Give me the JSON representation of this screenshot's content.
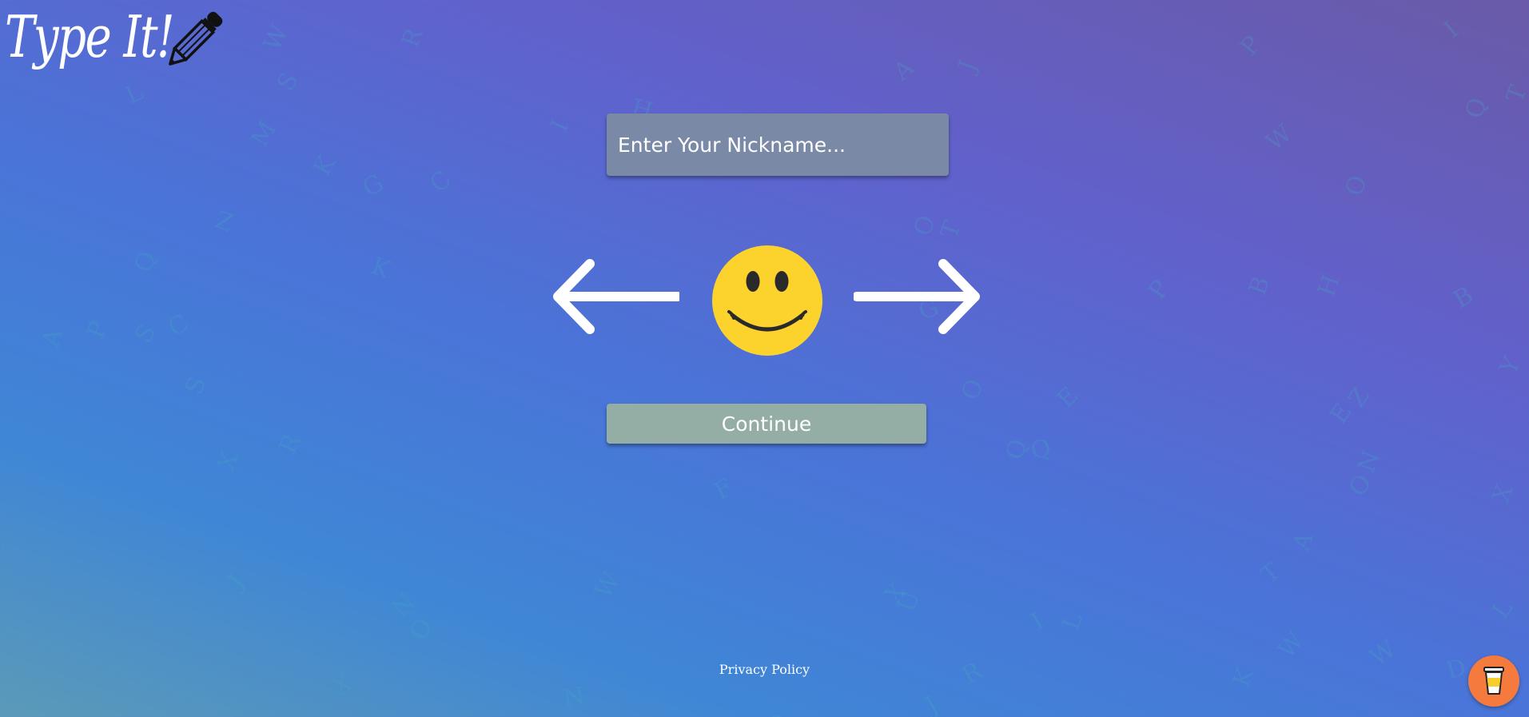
{
  "logo": {
    "title": "Type It!",
    "icon": "pencil-icon"
  },
  "nickname": {
    "placeholder": "Enter Your Nickname...",
    "value": ""
  },
  "avatar": {
    "icon": "smiley-face-icon",
    "prev_icon": "arrow-left-icon",
    "next_icon": "arrow-right-icon"
  },
  "continue_label": "Continue",
  "footer": {
    "privacy_label": "Privacy Policy"
  },
  "coffee": {
    "icon": "coffee-cup-icon"
  },
  "background": {
    "decorative_letters": [
      "W",
      "R",
      "S",
      "M",
      "L",
      "I",
      "H",
      "J",
      "W",
      "O",
      "T",
      "I",
      "K",
      "C",
      "G",
      "Z",
      "Q",
      "K",
      "A",
      "P",
      "S",
      "C",
      "S",
      "X",
      "R",
      "J",
      "N",
      "O",
      "X",
      "N",
      "A",
      "B",
      "H",
      "O",
      "I",
      "Z",
      "N",
      "X",
      "Y",
      "A",
      "L",
      "T",
      "O",
      "G",
      "P",
      "E",
      "Q",
      "W",
      "J",
      "T",
      "E",
      "K",
      "W",
      "L",
      "U",
      "B",
      "P",
      "Q",
      "D",
      "O",
      "R",
      "Q",
      "W",
      "F",
      "X",
      "O"
    ]
  },
  "colors": {
    "input_bg": "#7a8aa6",
    "continue_bg": "#94aea6",
    "smiley": "#fcd22c",
    "coffee_bg": "#f47a3e"
  }
}
